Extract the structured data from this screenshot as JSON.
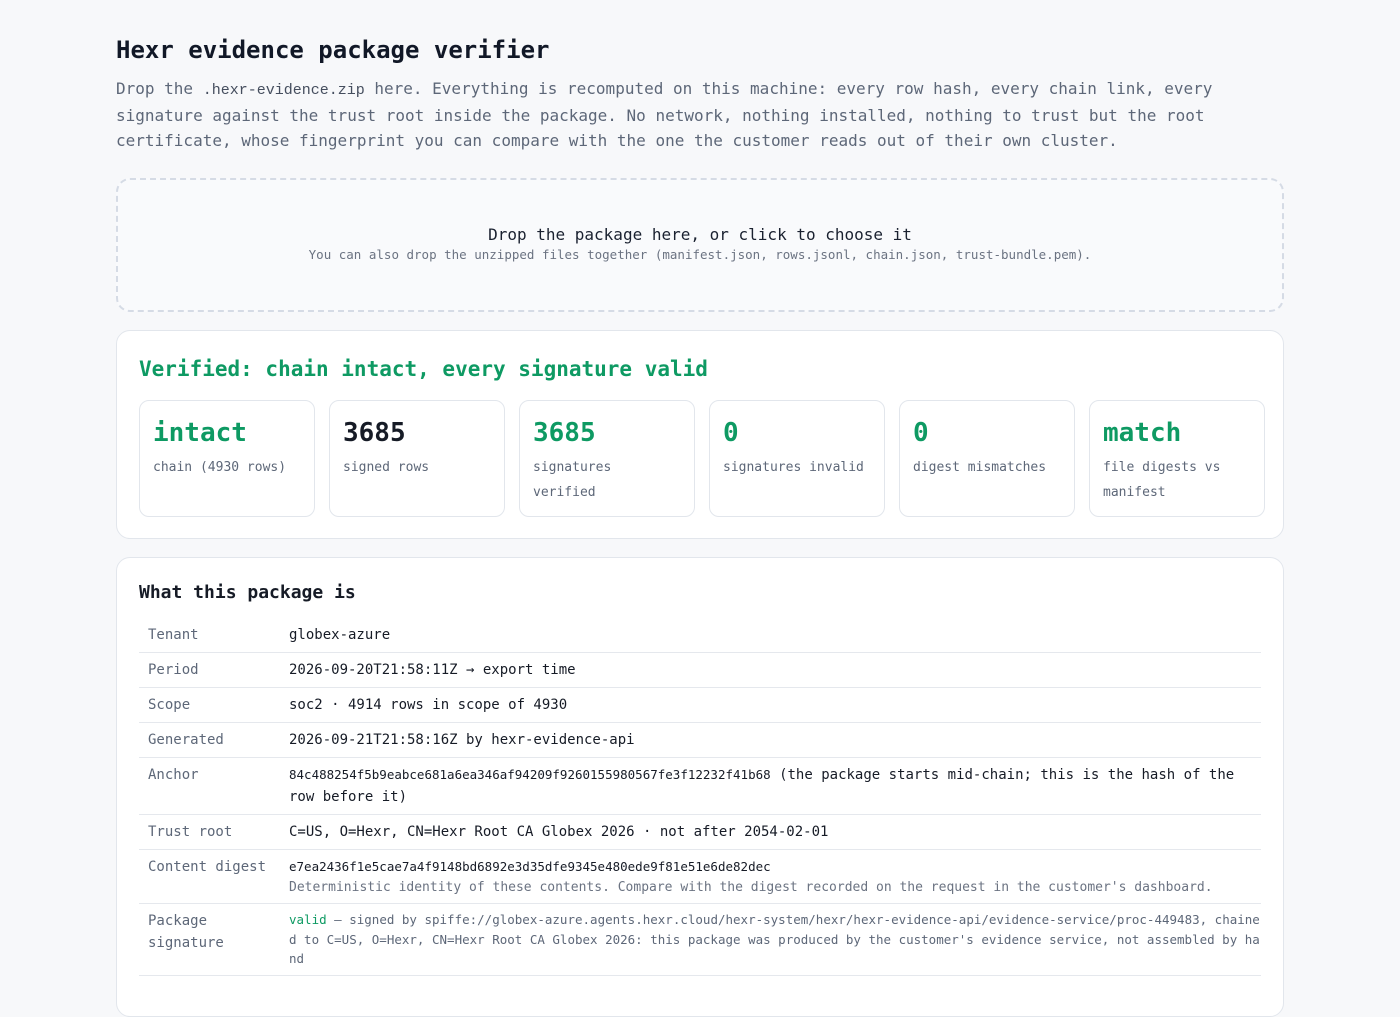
{
  "header": {
    "title": "Hexr evidence package verifier",
    "intro_before": "Drop the ",
    "intro_code": ".hexr-evidence.zip",
    "intro_after": " here. Everything is recomputed on this machine: every row hash, every chain link, every signature against the trust root inside the package. No network, nothing installed, nothing to trust but the root certificate, whose fingerprint you can compare with the one the customer reads out of their own cluster."
  },
  "dropzone": {
    "main": "Drop the package here, or click to choose it",
    "sub": "You can also drop the unzipped files together (manifest.json, rows.jsonl, chain.json, trust-bundle.pem)."
  },
  "verdict": {
    "title": "Verified: chain intact, every signature valid",
    "stats": [
      {
        "value": "intact",
        "label": "chain (4930 rows)",
        "accent": true
      },
      {
        "value": "3685",
        "label": "signed rows",
        "accent": false
      },
      {
        "value": "3685",
        "label": "signatures verified",
        "accent": true
      },
      {
        "value": "0",
        "label": "signatures invalid",
        "accent": true
      },
      {
        "value": "0",
        "label": "digest mismatches",
        "accent": true
      },
      {
        "value": "match",
        "label": "file digests vs manifest",
        "accent": true
      }
    ]
  },
  "package_info": {
    "title": "What this package is",
    "tenant": {
      "label": "Tenant",
      "value": "globex-azure"
    },
    "period": {
      "label": "Period",
      "value": "2026-09-20T21:58:11Z → export time"
    },
    "scope": {
      "label": "Scope",
      "value": "soc2 · 4914 rows in scope of 4930"
    },
    "generated": {
      "label": "Generated",
      "value": "2026-09-21T21:58:16Z by hexr-evidence-api"
    },
    "anchor": {
      "label": "Anchor",
      "hash": "84c488254f5b9eabce681a6ea346af94209f9260155980567fe3f12232f41b68",
      "note": " (the package starts mid-chain; this is the hash of the row before it)"
    },
    "trust_root": {
      "label": "Trust root",
      "value": "C=US, O=Hexr, CN=Hexr Root CA Globex 2026 · not after 2054-02-01"
    },
    "content_digest": {
      "label": "Content digest",
      "value": "e7ea2436f1e5cae7a4f9148bd6892e3d35dfe9345e480ede9f81e51e6de82dec",
      "note": "Deterministic identity of these contents. Compare with the digest recorded on the request in the customer's dashboard."
    },
    "package_signature": {
      "label": "Package signature",
      "status": "valid",
      "text": " — signed by spiffe://globex-azure.agents.hexr.cloud/hexr-system/hexr/hexr-evidence-api/evidence-service/proc-449483, chained to C=US, O=Hexr, CN=Hexr Root CA Globex 2026: this package was produced by the customer's evidence service, not assembled by hand"
    }
  }
}
